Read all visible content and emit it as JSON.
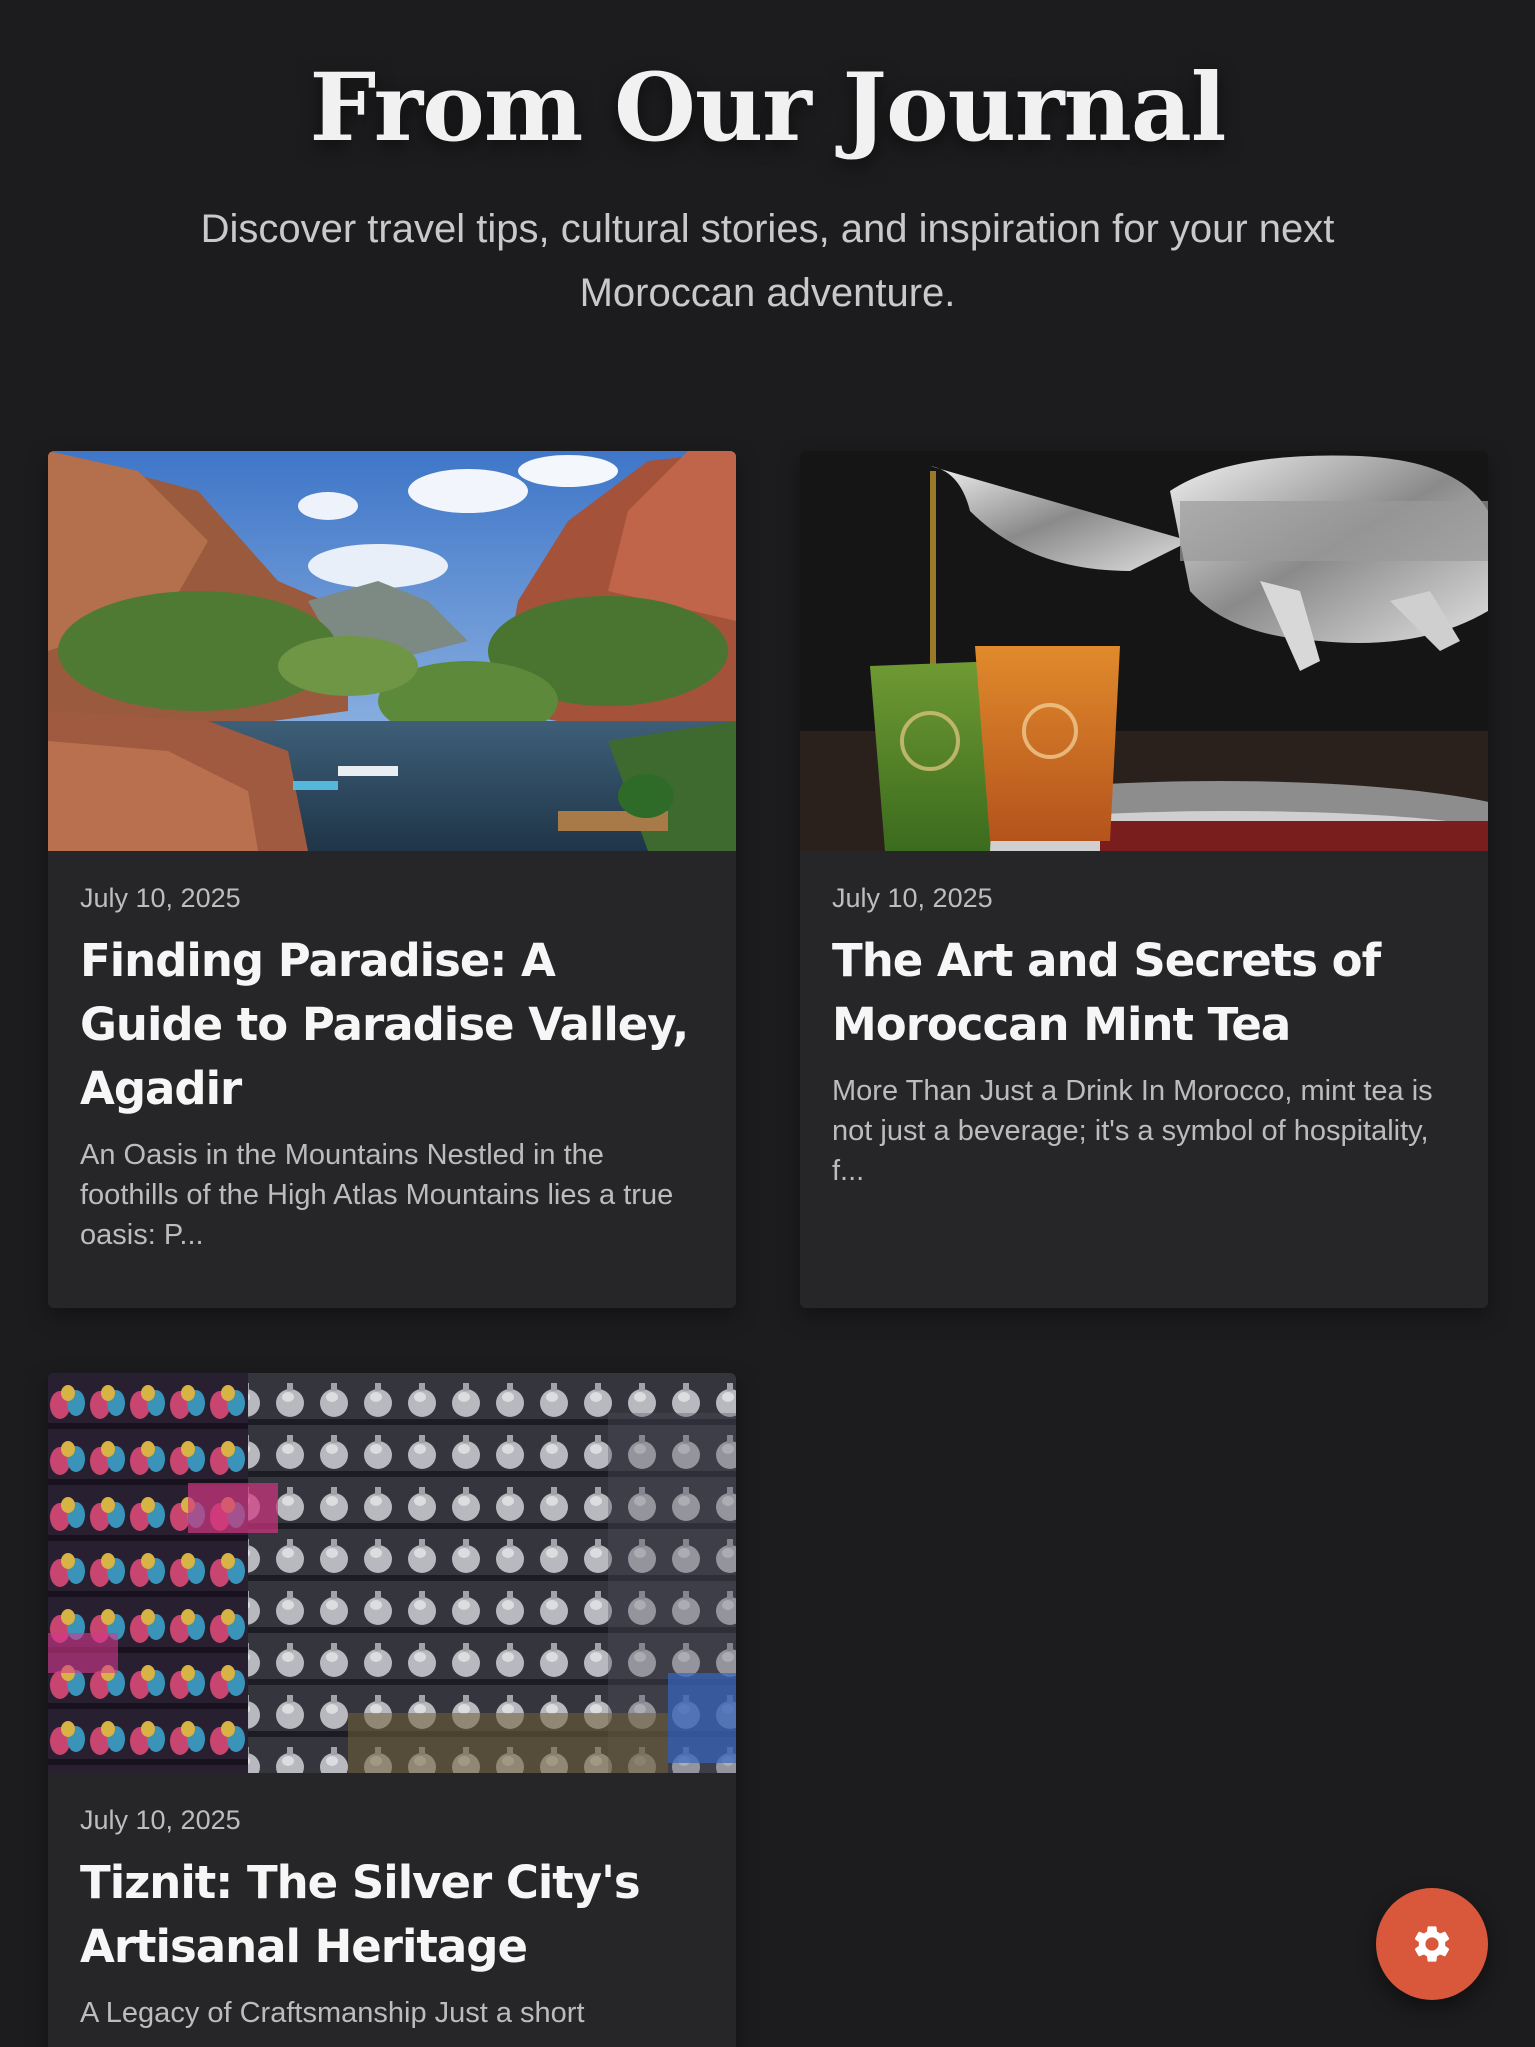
{
  "header": {
    "title": "From Our Journal",
    "subtitle": "Discover travel tips, cultural stories, and inspiration for your next Moroccan adventure."
  },
  "posts": [
    {
      "date": "July 10, 2025",
      "title": "Finding Paradise: A Guide to Paradise Valley, Agadir",
      "excerpt": "An Oasis in the Mountains Nestled in the foothills of the High Atlas Mountains lies a true oasis: P..."
    },
    {
      "date": "July 10, 2025",
      "title": "The Art and Secrets of Moroccan Mint Tea",
      "excerpt": "More Than Just a Drink In Morocco, mint tea is not just a beverage; it's a symbol of hospitality, f..."
    },
    {
      "date": "July 10, 2025",
      "title": "Tiznit: The Silver City's Artisanal Heritage",
      "excerpt": "A Legacy of Craftsmanship Just a short"
    }
  ],
  "fab": {
    "icon": "gear-icon",
    "color": "#d9583b"
  },
  "colors": {
    "background": "#1c1c1e",
    "card": "#262628",
    "accent": "#d9583b"
  }
}
